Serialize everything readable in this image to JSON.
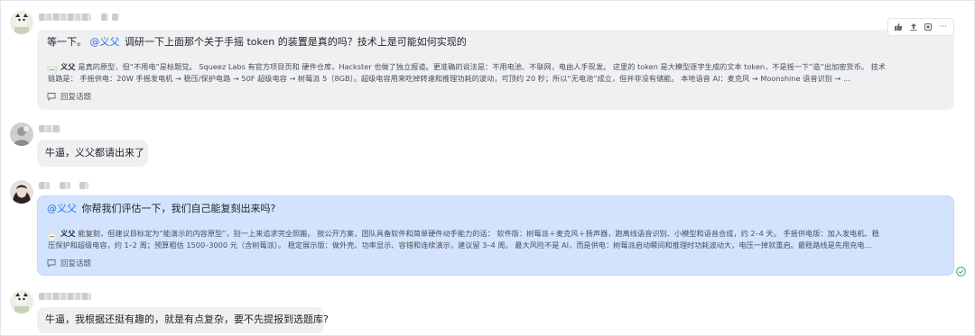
{
  "messages": [
    {
      "text_prefix": "等一下。",
      "mention": "@义父",
      "text": "调研一下上面那个关于手摇 token 的装置是真的吗？技术上是可能如何实现的",
      "reply": {
        "author": "义父",
        "line1": "是真的原型，但“不用电”是标题党。 Squeez Labs 有官方项目页和 硬件仓库，Hackster 也做了独立报道。更准确的说法是：不用电池、不联网，电由人手现发。 这里的 token 是大模型逐字生成的文本 token，不是摇一下“造”出加密货币。 技术",
        "line2": "链路是： 手摇供电：20W 手摇发电机 → 稳压/保护电路 → 50F 超级电容 → 树莓派 5（8GB）。超级电容用来吃掉转速和推理功耗的波动，可顶约 20 秒；所以“无电池”成立，但并非没有储能。 本地语音 AI：麦克风 → Moonshine 语音识别 → ..."
      },
      "reply_topic": "回复话题"
    },
    {
      "text": "牛逼，义父都请出来了"
    },
    {
      "mention": "@义父",
      "text": "你帮我们评估一下，我们自己能复刻出来吗?",
      "reply": {
        "author": "义父",
        "line1": "能复刻，但建议目标定为“能演示的内容原型”，别一上来追求完全照搬。 按公开方案，团队具备软件和简单硬件动手能力的话： 软件版：树莓派＋麦克风＋扬声器，跑离线语音识别、小模型和语音合成，约 2–4 天。 手摇供电版：加入发电机、稳",
        "line2": "压保护和超级电容，约 1–2 周；预算粗估 1500–3000 元（含树莓派）。 稳定展示版：做外壳、功率显示、容错和连续演示，建议留 3–4 周。 最大风险不是 AI，而是供电：树莓派启动瞬间和推理时功耗波动大，电压一掉就重启。最稳路线是先用充电..."
      },
      "reply_topic": "回复话题"
    },
    {
      "text": "牛逼，我根据还挺有趣的，就是有点复杂，要不先提报到选题库?"
    }
  ],
  "toolbar": {
    "icons": [
      "thumbs-up-icon",
      "share-icon",
      "pin-icon",
      "more-icon"
    ],
    "more_label": "···"
  },
  "colors": {
    "bubble_gray": "#eff0f1",
    "bubble_blue": "#d3e3fd",
    "mention": "#2f6fe4",
    "read_check": "#34b26a"
  }
}
